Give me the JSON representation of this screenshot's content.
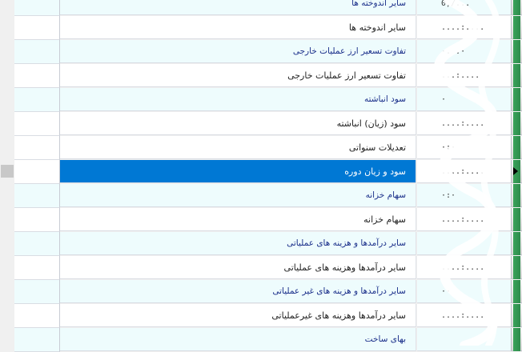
{
  "grid": {
    "rows": [
      {
        "kind": "header",
        "label": "سایر اندوخته ها",
        "value": "0,/..."
      },
      {
        "kind": "item",
        "label": "سایر اندوخته ها",
        "value": "....:...."
      },
      {
        "kind": "header",
        "label": "تفاوت تسعیر ارز عملیات خارجی",
        "value": "·. .·"
      },
      {
        "kind": "item",
        "label": "تفاوت تسعیر ارز عملیات خارجی",
        "value": "...:...."
      },
      {
        "kind": "header",
        "label": "سود انباشته",
        "value": "·"
      },
      {
        "kind": "item",
        "label": "سود (زیان) انباشته",
        "value": "....:...."
      },
      {
        "kind": "item",
        "label": "تعدیلات سنواتی",
        "value": "·:·"
      },
      {
        "kind": "selected",
        "label": "سود و زیان دوره",
        "value": "....:...."
      },
      {
        "kind": "header",
        "label": "سهام خزانه",
        "value": "·:·"
      },
      {
        "kind": "item",
        "label": "سهام خزانه",
        "value": "....:...."
      },
      {
        "kind": "header",
        "label": "سایر درآمدها و هزینه های عملیاتی",
        "value": ""
      },
      {
        "kind": "item",
        "label": "سایر درآمدها وهزینه های عملیاتی",
        "value": "....:...."
      },
      {
        "kind": "header",
        "label": "سایر درآمدها و هزینه های غیر عملیاتی",
        "value": "··"
      },
      {
        "kind": "item",
        "label": "سایر درآمدها وهزینه های غیرعملیاتی",
        "value": "....:...."
      },
      {
        "kind": "header",
        "label": "بهای ساخت",
        "value": ""
      }
    ]
  },
  "colors": {
    "header_bg": "#eefcfd",
    "header_text": "#1a2f8a",
    "item_bg": "#ffffff",
    "selected_bg": "#0078d4",
    "selected_text": "#ffffff",
    "right_nub": "#2e8b4c"
  },
  "icons": {
    "current_row_indicator": "triangle-right-icon"
  }
}
